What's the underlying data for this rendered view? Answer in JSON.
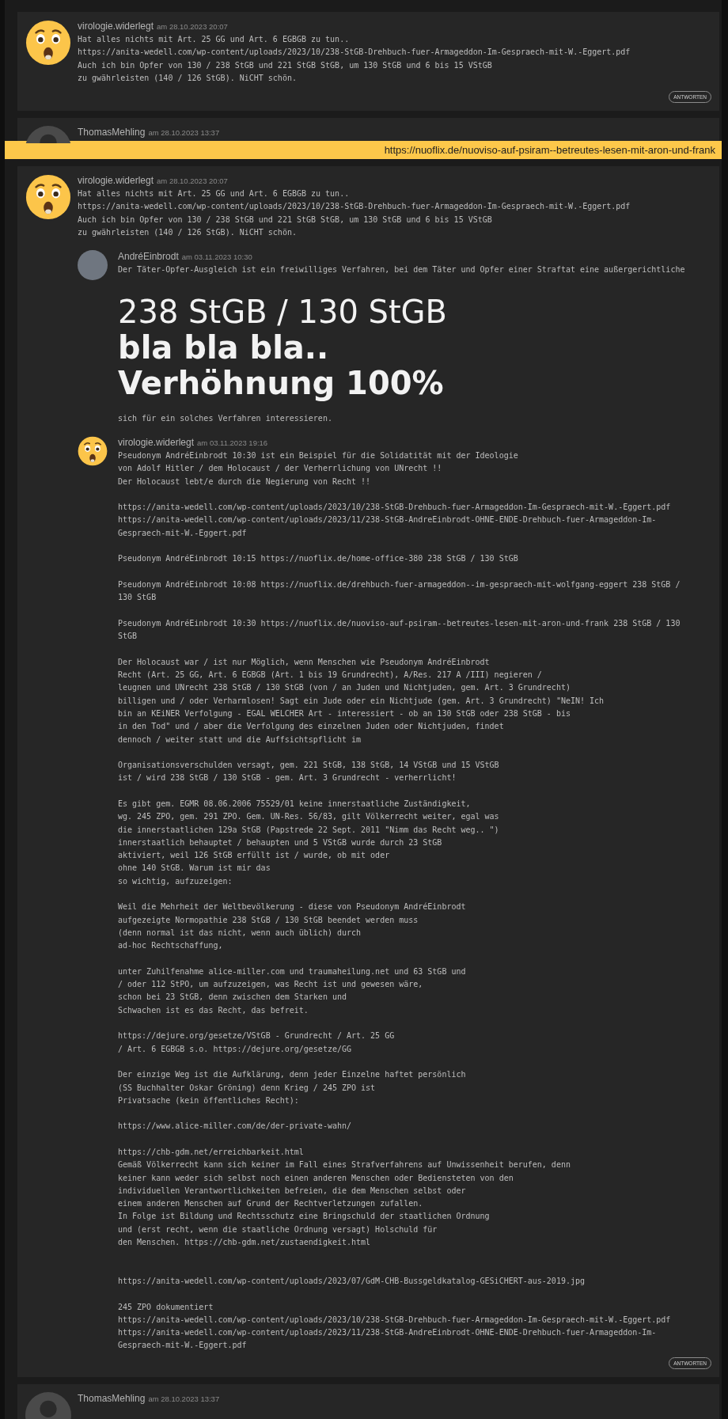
{
  "feed": [
    {
      "kind": "comment",
      "avatar": {
        "kind": "emoji"
      },
      "author": "virologie.widerlegt",
      "date": "am 28.10.2023 20:07",
      "body": "Hat alles nichts mit Art. 25 GG und Art. 6 EGBGB zu tun..\nhttps://anita-wedell.com/wp-content/uploads/2023/10/238-StGB-Drehbuch-fuer-Armageddon-Im-Gespraech-mit-W.-Eggert.pdf\nAuch ich bin Opfer von 130 / 238 StGB und 221 StGB StGB, um 130 StGB und 6 bis 15 VStGB\nzu gwährleisten (140 / 126 StGB). NiCHT schön.",
      "reply_button": "ANTWORTEN"
    },
    {
      "kind": "comment",
      "avatar": {
        "kind": "silhouette"
      },
      "author": "ThomasMehling",
      "date": "am 28.10.2023 13:37"
    },
    {
      "kind": "banner",
      "url": "https://nuoflix.de/nuoviso-auf-psiram--betreutes-lesen-mit-aron-und-frank"
    },
    {
      "kind": "comment",
      "avatar": {
        "kind": "emoji"
      },
      "author": "virologie.widerlegt",
      "date": "am 28.10.2023 20:07",
      "body": "Hat alles nichts mit Art. 25 GG und Art. 6 EGBGB zu tun..\nhttps://anita-wedell.com/wp-content/uploads/2023/10/238-StGB-Drehbuch-fuer-Armageddon-Im-Gespraech-mit-W.-Eggert.pdf\nAuch ich bin Opfer von 130 / 238 StGB und 221 StGB StGB, um 130 StGB und 6 bis 15 VStGB\nzu gwährleisten (140 / 126 StGB). NiCHT schön.",
      "replies": [
        {
          "avatar": {
            "kind": "photo"
          },
          "author": "AndréEinbrodt",
          "date": "am 03.11.2023 10:30",
          "body": "Der Täter-Opfer-Ausgleich ist ein freiwilliges Verfahren, bei dem Täter und Opfer einer Straftat eine außergerichtliche",
          "headline": [
            {
              "text": "238 StGB / 130 StGB",
              "bold": false
            },
            {
              "text": "bla bla bla..",
              "bold": true
            },
            {
              "text": "Verhöhnung 100%",
              "bold": true
            }
          ],
          "body_after": "sich für ein solches Verfahren interessieren."
        },
        {
          "avatar": {
            "kind": "emoji"
          },
          "author": "virologie.widerlegt",
          "date": "am 03.11.2023 19:16",
          "body": "Pseudonym AndréEinbrodt 10:30 ist ein Beispiel für die Solidatität mit der Ideologie\nvon Adolf Hitler / dem Holocaust / der Verherrlichung von UNrecht !!\nDer Holocaust lebt/e durch die Negierung von Recht !!\n\nhttps://anita-wedell.com/wp-content/uploads/2023/10/238-StGB-Drehbuch-fuer-Armageddon-Im-Gespraech-mit-W.-Eggert.pdf\nhttps://anita-wedell.com/wp-content/uploads/2023/11/238-StGB-AndreEinbrodt-OHNE-ENDE-Drehbuch-fuer-Armageddon-Im-\nGespraech-mit-W.-Eggert.pdf\n\nPseudonym AndréEinbrodt 10:15 https://nuoflix.de/home-office-380 238 StGB / 130 StGB\n\nPseudonym AndréEinbrodt 10:08 https://nuoflix.de/drehbuch-fuer-armageddon--im-gespraech-mit-wolfgang-eggert 238 StGB /\n130 StGB\n\nPseudonym AndréEinbrodt 10:30 https://nuoflix.de/nuoviso-auf-psiram--betreutes-lesen-mit-aron-und-frank 238 StGB / 130\nStGB\n\nDer Holocaust war / ist nur Möglich, wenn Menschen wie Pseudonym AndréEinbrodt\nRecht (Art. 25 GG, Art. 6 EGBGB (Art. 1 bis 19 Grundrecht), A/Res. 217 A /III) negieren /\nleugnen und UNrecht 238 StGB / 130 StGB (von / an Juden und Nichtjuden, gem. Art. 3 Grundrecht)\nbilligen und / oder Verharmlosen! Sagt ein Jude oder ein Nichtjude (gem. Art. 3 Grundrecht) \"NeIN! Ich\nbin an KEiNER Verfolgung - EGAL WELCHER Art - interessiert - ob an 130 StGB oder 238 StGB - bis\nin den Tod\" und / aber die Verfolgung des einzelnen Juden oder Nichtjuden, findet\ndennoch / weiter statt und die Auffsichtspflicht im\n\nOrganisationsverschulden versagt, gem. 221 StGB, 138 StGB, 14 VStGB und 15 VStGB\nist / wird 238 StGB / 130 StGB - gem. Art. 3 Grundrecht - verherrlicht!\n\nEs gibt gem. EGMR 08.06.2006 75529/01 keine innerstaatliche Zuständigkeit,\nwg. 245 ZPO, gem. 291 ZPO. Gem. UN-Res. 56/83, gilt Völkerrecht weiter, egal was\ndie innerstaatlichen 129a StGB (Papstrede 22 Sept. 2011 \"Nimm das Recht weg.. \")\ninnerstaatlich behauptet / behaupten und 5 VStGB wurde durch 23 StGB\naktiviert, weil 126 StGB erfüllt ist / wurde, ob mit oder\nohne 140 StGB. Warum ist mir das\nso wichtig, aufzuzeigen:\n\nWeil die Mehrheit der Weltbevölkerung - diese von Pseudonym AndréEinbrodt\naufgezeigte Normopathie 238 StGB / 130 StGB beendet werden muss\n(denn normal ist das nicht, wenn auch üblich) durch\nad-hoc Rechtschaffung,\n\nunter Zuhilfenahme alice-miller.com und traumaheilung.net und 63 StGB und\n/ oder 112 StPO, um aufzuzeigen, was Recht ist und gewesen wäre,\nschon bei 23 StGB, denn zwischen dem Starken und\nSchwachen ist es das Recht, das befreit.\n\nhttps://dejure.org/gesetze/VStGB - Grundrecht / Art. 25 GG\n/ Art. 6 EGBGB s.o. https://dejure.org/gesetze/GG\n\nDer einzige Weg ist die Aufklärung, denn jeder Einzelne haftet persönlich\n(SS Buchhalter Oskar Gröning) denn Krieg / 245 ZPO ist\nPrivatsache (kein öffentliches Recht):\n\nhttps://www.alice-miller.com/de/der-private-wahn/\n\nhttps://chb-gdm.net/erreichbarkeit.html\nGemäß Völkerrecht kann sich keiner im Fall eines Strafverfahrens auf Unwissenheit berufen, denn\nkeiner kann weder sich selbst noch einen anderen Menschen oder Bediensteten von den\nindividuellen Verantwortlichkeiten befreien, die dem Menschen selbst oder\neinem anderen Menschen auf Grund der Rechtverletzungen zufallen.\nIn Folge ist Bildung und Rechtsschutz eine Bringschuld der staatlichen Ordnung\nund (erst recht, wenn die staatliche Ordnung versagt) Holschuld für\nden Menschen. https://chb-gdm.net/zustaendigkeit.html\n\n\nhttps://anita-wedell.com/wp-content/uploads/2023/07/GdM-CHB-Bussgeldkatalog-GESiCHERT-aus-2019.jpg\n\n245 ZPO dokumentiert\nhttps://anita-wedell.com/wp-content/uploads/2023/10/238-StGB-Drehbuch-fuer-Armageddon-Im-Gespraech-mit-W.-Eggert.pdf\nhttps://anita-wedell.com/wp-content/uploads/2023/11/238-StGB-AndreEinbrodt-OHNE-ENDE-Drehbuch-fuer-Armageddon-Im-\nGespraech-mit-W.-Eggert.pdf"
        }
      ],
      "reply_button": "ANTWORTEN"
    },
    {
      "kind": "comment",
      "avatar": {
        "kind": "silhouette"
      },
      "author": "ThomasMehling",
      "date": "am 28.10.2023 13:37"
    }
  ]
}
